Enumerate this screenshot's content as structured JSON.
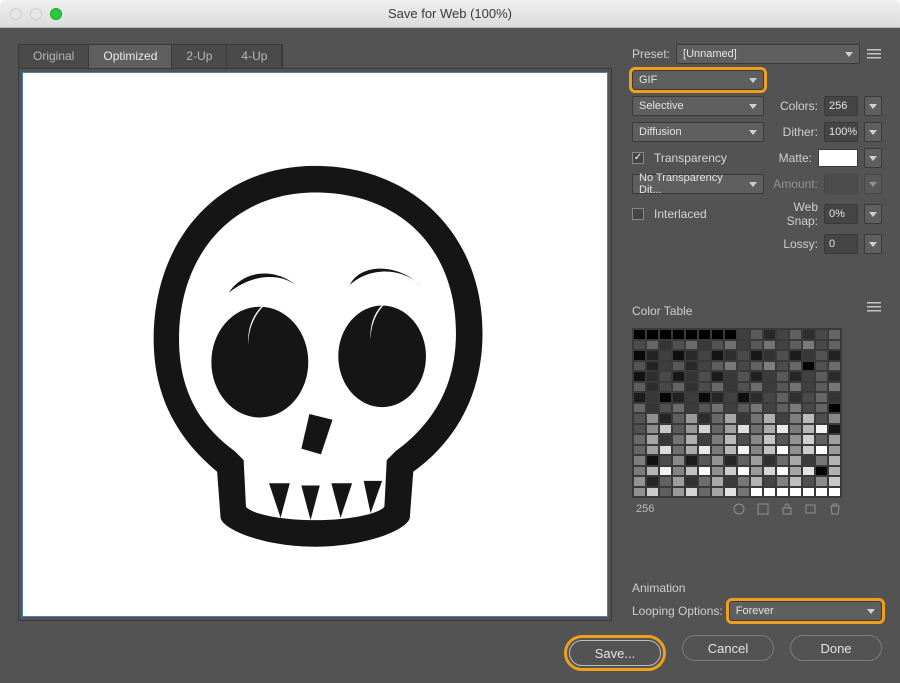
{
  "window": {
    "title": "Save for Web (100%)"
  },
  "tabs": {
    "original": "Original",
    "optimized": "Optimized",
    "twoup": "2-Up",
    "fourup": "4-Up"
  },
  "preset": {
    "label": "Preset:",
    "value": "[Unnamed]"
  },
  "format": {
    "value": "GIF"
  },
  "reduction": {
    "value": "Selective"
  },
  "colors": {
    "label": "Colors:",
    "value": "256"
  },
  "dither_method": {
    "value": "Diffusion"
  },
  "dither": {
    "label": "Dither:",
    "value": "100%"
  },
  "transparency": {
    "label": "Transparency",
    "checked": true
  },
  "matte": {
    "label": "Matte:"
  },
  "trans_dither": {
    "value": "No Transparency Dit..."
  },
  "amount": {
    "label": "Amount:"
  },
  "interlaced": {
    "label": "Interlaced",
    "checked": false
  },
  "websnap": {
    "label": "Web Snap:",
    "value": "0%"
  },
  "lossy": {
    "label": "Lossy:",
    "value": "0"
  },
  "color_table": {
    "label": "Color Table",
    "count": "256"
  },
  "animation": {
    "label": "Animation",
    "looping_label": "Looping Options:",
    "looping_value": "Forever"
  },
  "buttons": {
    "save": "Save...",
    "cancel": "Cancel",
    "done": "Done"
  }
}
